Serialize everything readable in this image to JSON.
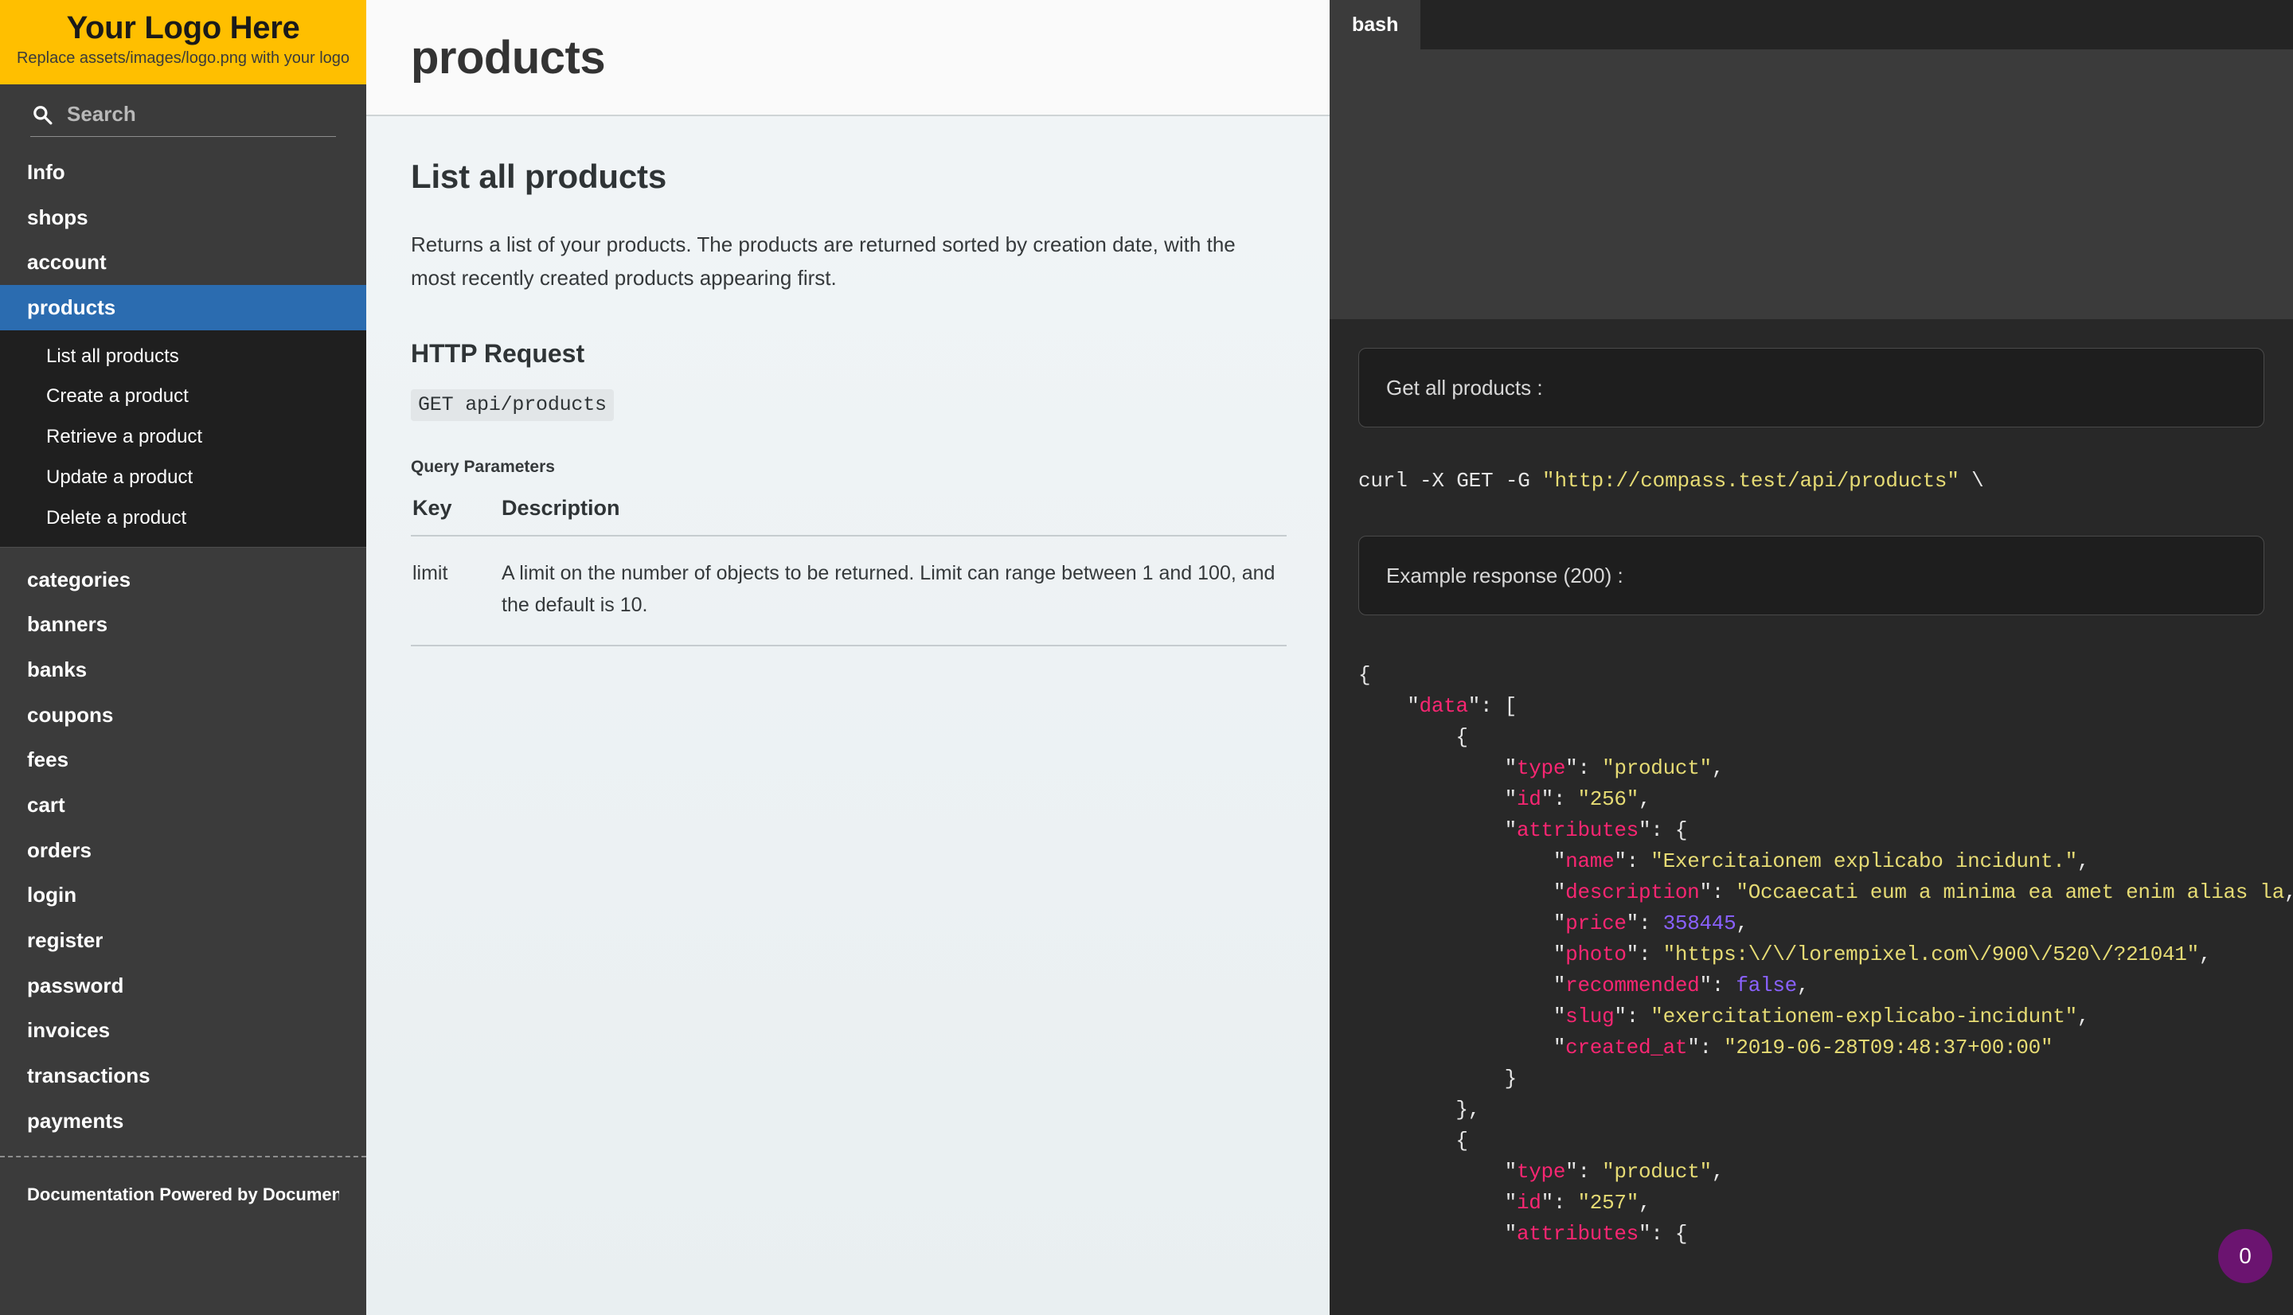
{
  "sidebar": {
    "logo": {
      "title": "Your Logo Here",
      "subtitle": "Replace assets/images/logo.png with your logo"
    },
    "search": {
      "placeholder": "Search",
      "value": ""
    },
    "nav": [
      {
        "label": "Info",
        "active": false
      },
      {
        "label": "shops",
        "active": false
      },
      {
        "label": "account",
        "active": false
      },
      {
        "label": "products",
        "active": true
      }
    ],
    "subnav": [
      {
        "label": "List all products"
      },
      {
        "label": "Create a product"
      },
      {
        "label": "Retrieve a product"
      },
      {
        "label": "Update a product"
      },
      {
        "label": "Delete a product"
      }
    ],
    "nav_rest": [
      {
        "label": "categories"
      },
      {
        "label": "banners"
      },
      {
        "label": "banks"
      },
      {
        "label": "coupons"
      },
      {
        "label": "fees"
      },
      {
        "label": "cart"
      },
      {
        "label": "orders"
      },
      {
        "label": "login"
      },
      {
        "label": "register"
      },
      {
        "label": "password"
      },
      {
        "label": "invoices"
      },
      {
        "label": "transactions"
      },
      {
        "label": "payments"
      }
    ],
    "footer": "Documentation Powered by Documen…"
  },
  "content": {
    "page_title": "products",
    "heading": "List all products",
    "description": "Returns a list of your products. The products are returned sorted by creation date, with the most recently created products appearing first.",
    "http_request_heading": "HTTP Request",
    "http_request_code": "GET api/products",
    "query_params_title": "Query Parameters",
    "table": {
      "headers": [
        "Key",
        "Description"
      ],
      "rows": [
        {
          "key": "limit",
          "description": "A limit on the number of objects to be returned. Limit can range between 1 and 100, and the default is 10."
        }
      ]
    }
  },
  "codepanel": {
    "tab_label": "bash",
    "callout_request": "Get all products :",
    "curl_command_prefix": "curl -X GET -G ",
    "curl_url": "\"http://compass.test/api/products\"",
    "curl_command_suffix": " \\",
    "callout_response": "Example response (200) :",
    "badge_count": "0",
    "response_json": {
      "open_brace": "{",
      "data_key": "\"data\"",
      "lines": [
        {
          "indent": 2,
          "text": "\"data\": [",
          "kind": "key-open"
        },
        {
          "indent": 3,
          "text": "{",
          "kind": "punc"
        },
        {
          "indent": 4,
          "key": "\"type\"",
          "value": "\"product\"",
          "kind": "str"
        },
        {
          "indent": 4,
          "key": "\"id\"",
          "value": "\"256\"",
          "kind": "str"
        },
        {
          "indent": 4,
          "key": "\"attributes\"",
          "value": "{",
          "kind": "obj"
        },
        {
          "indent": 5,
          "key": "\"name\"",
          "value": "\"Exercitaionem explicabo incidunt.\"",
          "kind": "str"
        },
        {
          "indent": 5,
          "key": "\"description\"",
          "value": "\"Occaecati eum a minima ea amet enim alias la",
          "kind": "str"
        },
        {
          "indent": 5,
          "key": "\"price\"",
          "value": "358445",
          "kind": "num"
        },
        {
          "indent": 5,
          "key": "\"photo\"",
          "value": "\"https:\\/\\/lorempixel.com\\/900\\/520\\/?21041\"",
          "kind": "str"
        },
        {
          "indent": 5,
          "key": "\"recommended\"",
          "value": "false",
          "kind": "bool"
        },
        {
          "indent": 5,
          "key": "\"slug\"",
          "value": "\"exercitationem-explicabo-incidunt\"",
          "kind": "str"
        },
        {
          "indent": 5,
          "key": "\"created_at\"",
          "value": "\"2019-06-28T09:48:37+00:00\"",
          "kind": "str-last"
        },
        {
          "indent": 4,
          "text": "}",
          "kind": "punc"
        },
        {
          "indent": 3,
          "text": "},",
          "kind": "punc"
        },
        {
          "indent": 3,
          "text": "{",
          "kind": "punc"
        },
        {
          "indent": 4,
          "key": "\"type\"",
          "value": "\"product\"",
          "kind": "str"
        },
        {
          "indent": 4,
          "key": "\"id\"",
          "value": "\"257\"",
          "kind": "str"
        },
        {
          "indent": 4,
          "key": "\"attributes\"",
          "value": "{",
          "kind": "obj"
        }
      ]
    }
  }
}
